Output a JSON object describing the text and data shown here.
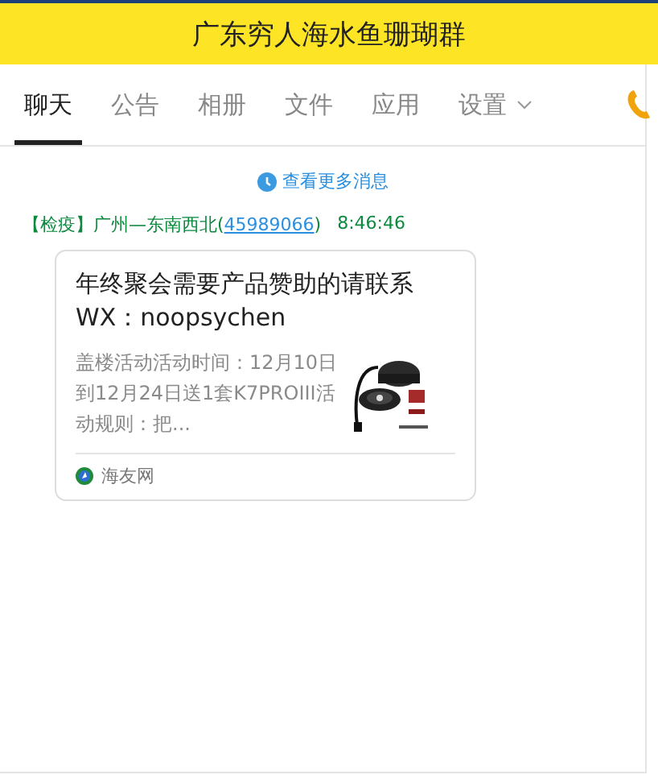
{
  "window": {
    "title": "广东穷人海水鱼珊瑚群"
  },
  "tabs": [
    {
      "label": "聊天",
      "selected": true,
      "dropdown": false
    },
    {
      "label": "公告",
      "selected": false,
      "dropdown": false
    },
    {
      "label": "相册",
      "selected": false,
      "dropdown": false
    },
    {
      "label": "文件",
      "selected": false,
      "dropdown": false
    },
    {
      "label": "应用",
      "selected": false,
      "dropdown": false
    },
    {
      "label": "设置",
      "selected": false,
      "dropdown": true
    }
  ],
  "more_messages": "查看更多消息",
  "messages": [
    {
      "sender_before": "【检疫】广州—东南西北(",
      "sender_id": "45989066",
      "sender_after": ")",
      "time": "8:46:46",
      "card": {
        "title": "年终聚会需要产品赞助的请联系WX：noopsychen",
        "summary": "盖楼活动活动时间：12月10日到12月24日送1套K7PROIII活动规则：把...",
        "source": "海友网"
      }
    }
  ]
}
